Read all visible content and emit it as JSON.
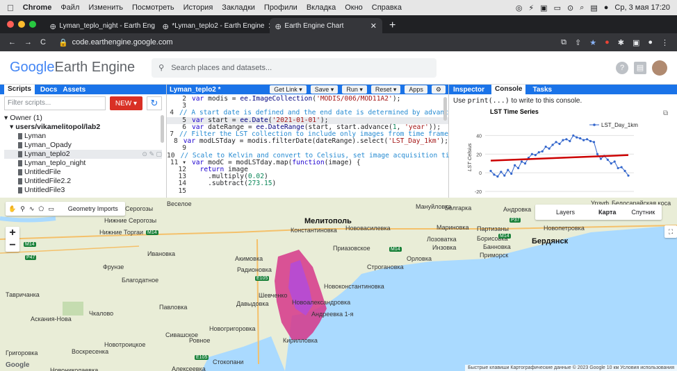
{
  "macmenu": {
    "app": "Chrome",
    "items": [
      "Файл",
      "Изменить",
      "Посмотреть",
      "История",
      "Закладки",
      "Профили",
      "Вкладка",
      "Окно",
      "Справка"
    ],
    "clock": "Ср, 3 мая 17:20"
  },
  "browser": {
    "tabs": [
      {
        "label": "Lyman_teplo_night - Earth Eng"
      },
      {
        "label": "*Lyman_teplo2 - Earth Engine"
      },
      {
        "label": "Earth Engine Chart"
      }
    ],
    "url": "code.earthengine.google.com"
  },
  "gee": {
    "logo_google": "Google",
    "logo_rest": " Earth Engine",
    "search_placeholder": "Search places and datasets..."
  },
  "left": {
    "tabs": [
      "Scripts",
      "Docs",
      "Assets"
    ],
    "filter_placeholder": "Filter scripts...",
    "new_label": "NEW ▾",
    "owner": "Owner (1)",
    "repo": "users/vikamelitopol/lab2",
    "files": [
      "Lyman",
      "Lyman_Opady",
      "Lyman_teplo2",
      "Lyman_teplo_night",
      "UntitledFile",
      "UntitledFile2.2",
      "UntitledFile3"
    ]
  },
  "editor": {
    "title": "Lyman_teplo2 *",
    "buttons": [
      "Get Link ▾",
      "Save ▾",
      "Run ▾",
      "Reset ▾",
      "Apps"
    ],
    "lines": [
      {
        "n": "2",
        "html": "<span class='kw'>var</span> modis = <span class='fn'>ee.ImageCollection</span>(<span class='str'>'MODIS/006/MOD11A2'</span>);"
      },
      {
        "n": "3",
        "html": ""
      },
      {
        "n": "4",
        "html": "<span class='cm'>// A start date is defined and the end date is determined by advanc</span>"
      },
      {
        "n": "5",
        "html": "<span class='kw'>var</span> start = <span class='fn'>ee.Date</span>(<span class='str'>'2021-01-01'</span>);",
        "hl": true
      },
      {
        "n": "6",
        "html": "<span class='kw'>var</span> dateRange = <span class='fn'>ee.DateRange</span>(start, start.advance(<span class='num'>1</span>, <span class='str'>'year'</span>));"
      },
      {
        "n": "7",
        "html": "<span class='cm'>// Filter the LST collection to include only images from time frame</span>"
      },
      {
        "n": "8",
        "html": "<span class='kw'>var</span> modLSTday = modis.filterDate(dateRange).select(<span class='str'>'LST_Day_1km'</span>);"
      },
      {
        "n": "9",
        "html": ""
      },
      {
        "n": "10",
        "html": "<span class='cm'>// Scale to Kelvin and convert to Celsius, set image acquisition ti</span>"
      },
      {
        "n": "11 ▾",
        "html": "<span class='kw'>var</span> modC = modLSTday.map(<span class='kw'>function</span>(image) {"
      },
      {
        "n": "12",
        "html": "  <span class='kw'>return</span> image"
      },
      {
        "n": "13",
        "html": "    .multiply(<span class='num'>0.02</span>)"
      },
      {
        "n": "14",
        "html": "    .subtract(<span class='num'>273.15</span>)"
      },
      {
        "n": "15",
        "html": ""
      }
    ]
  },
  "right": {
    "tabs": [
      "Inspector",
      "Console",
      "Tasks"
    ],
    "hint_pre": "Use ",
    "hint_code": "print(...)",
    "hint_post": " to write to this console."
  },
  "chart_data": {
    "type": "line",
    "title": "LST Time Series",
    "ylabel": "LST Celsius",
    "xlabel": "",
    "ylim": [
      -20,
      50
    ],
    "yticks": [
      -20,
      0,
      20,
      40
    ],
    "series": [
      {
        "name": "LST_Day_1km",
        "values": [
          2,
          -2,
          -4,
          1,
          -3,
          3,
          -1,
          8,
          5,
          12,
          10,
          16,
          20,
          19,
          22,
          23,
          28,
          26,
          30,
          33,
          31,
          35,
          36,
          34,
          40,
          38,
          37,
          35,
          36,
          34,
          33,
          20,
          15,
          18,
          14,
          10,
          12,
          5,
          6,
          2,
          -3
        ]
      }
    ],
    "trend": {
      "start": 13,
      "end": 19
    },
    "legend": "top-right"
  },
  "map": {
    "layers_label": "Layers",
    "karta_label": "Карта",
    "sputnik_label": "Спутник",
    "geometry_imports": "Geometry Imports",
    "places": [
      {
        "t": "Мелитополь",
        "x": 438,
        "y": 28,
        "big": true
      },
      {
        "t": "Константиновка",
        "x": 418,
        "y": 42
      },
      {
        "t": "Нововасилевка",
        "x": 497,
        "y": 39
      },
      {
        "t": "Мануйловка",
        "x": 598,
        "y": 8
      },
      {
        "t": "Болгарка",
        "x": 640,
        "y": 10
      },
      {
        "t": "Андровка",
        "x": 724,
        "y": 12
      },
      {
        "t": "Мариновка",
        "x": 628,
        "y": 38
      },
      {
        "t": "Партизаны",
        "x": 686,
        "y": 40
      },
      {
        "t": "Новопетровка",
        "x": 782,
        "y": 39
      },
      {
        "t": "Борисовка",
        "x": 686,
        "y": 54
      },
      {
        "t": "Бердянск",
        "x": 765,
        "y": 57,
        "big": true
      },
      {
        "t": "Лозоватка",
        "x": 614,
        "y": 55
      },
      {
        "t": "Инзовка",
        "x": 622,
        "y": 67
      },
      {
        "t": "Банновка",
        "x": 695,
        "y": 66
      },
      {
        "t": "Приморск",
        "x": 690,
        "y": 78
      },
      {
        "t": "Орловка",
        "x": 585,
        "y": 83
      },
      {
        "t": "Строгановка",
        "x": 528,
        "y": 95
      },
      {
        "t": "Приазовское",
        "x": 479,
        "y": 68
      },
      {
        "t": "Акимовка",
        "x": 338,
        "y": 83
      },
      {
        "t": "Радионовка",
        "x": 341,
        "y": 99
      },
      {
        "t": "Новоконстантиновка",
        "x": 466,
        "y": 123
      },
      {
        "t": "Давыдовка",
        "x": 340,
        "y": 148
      },
      {
        "t": "Шевченко",
        "x": 372,
        "y": 136
      },
      {
        "t": "Новоалександровка",
        "x": 420,
        "y": 146
      },
      {
        "t": "Андреевка 1-я",
        "x": 448,
        "y": 163
      },
      {
        "t": "Кирилловка",
        "x": 407,
        "y": 201
      },
      {
        "t": "Ивановка",
        "x": 212,
        "y": 76
      },
      {
        "t": "Фрунзе",
        "x": 148,
        "y": 95
      },
      {
        "t": "Благодатное",
        "x": 175,
        "y": 114
      },
      {
        "t": "Тавричанка",
        "x": 8,
        "y": 135
      },
      {
        "t": "Чкалово",
        "x": 128,
        "y": 162
      },
      {
        "t": "Павловка",
        "x": 229,
        "y": 153
      },
      {
        "t": "Аскания-Нова",
        "x": 44,
        "y": 170
      },
      {
        "t": "Новогригоровка",
        "x": 301,
        "y": 184
      },
      {
        "t": "Сивашское",
        "x": 238,
        "y": 193
      },
      {
        "t": "Ровное",
        "x": 272,
        "y": 201
      },
      {
        "t": "Новотроицкое",
        "x": 150,
        "y": 207
      },
      {
        "t": "Воскресенка",
        "x": 103,
        "y": 217
      },
      {
        "t": "Стокопани",
        "x": 306,
        "y": 232
      },
      {
        "t": "Алексеевка",
        "x": 247,
        "y": 242
      },
      {
        "t": "Григоровка",
        "x": 8,
        "y": 219
      },
      {
        "t": "Новониколаевка",
        "x": 72,
        "y": 244
      },
      {
        "t": "Серогозы",
        "x": 180,
        "y": 11
      },
      {
        "t": "Нижние Серогозы",
        "x": 150,
        "y": 28
      },
      {
        "t": "Нижние Торгаи",
        "x": 143,
        "y": 45
      },
      {
        "t": "Веселое",
        "x": 240,
        "y": 4
      },
      {
        "t": "Урзуф",
        "x": 850,
        "y": 3
      },
      {
        "t": "Белосарайская коса",
        "x": 880,
        "y": 3
      }
    ],
    "roads": [
      {
        "t": "M14",
        "x": 210,
        "y": 47
      },
      {
        "t": "M14",
        "x": 34,
        "y": 64
      },
      {
        "t": "P47",
        "x": 36,
        "y": 83
      },
      {
        "t": "M14",
        "x": 560,
        "y": 71
      },
      {
        "t": "M14",
        "x": 717,
        "y": 52
      },
      {
        "t": "P37",
        "x": 733,
        "y": 29
      },
      {
        "t": "E105",
        "x": 367,
        "y": 113
      },
      {
        "t": "E105",
        "x": 280,
        "y": 227
      }
    ],
    "attribution": "Быстрые клавиши   Картографические данные © 2023 Google   10 км   Условия использования"
  }
}
